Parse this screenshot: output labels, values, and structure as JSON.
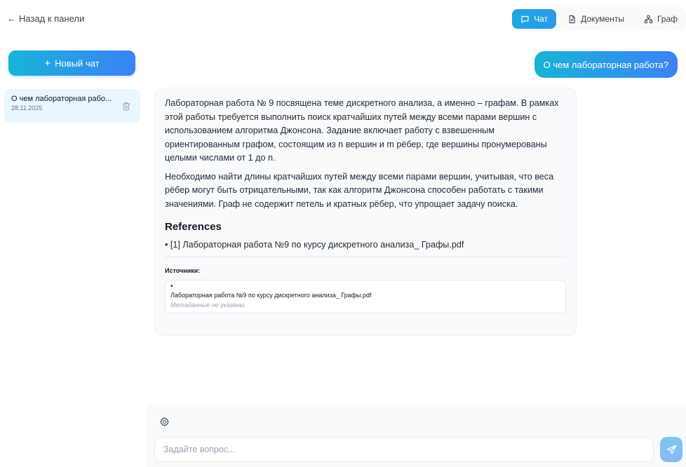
{
  "header": {
    "back_label": "Назад к панели",
    "tabs": [
      {
        "label": "Чат",
        "icon": "chat-icon",
        "active": true
      },
      {
        "label": "Документы",
        "icon": "document-icon",
        "active": false
      },
      {
        "label": "Граф",
        "icon": "graph-icon",
        "active": false
      }
    ]
  },
  "sidebar": {
    "new_chat_label": "Новый чат",
    "chats": [
      {
        "title": "О чем лабораторная рабо...",
        "date": "28.11.2025"
      }
    ]
  },
  "conversation": {
    "user_message": "О чем лабораторная работа?",
    "answer": {
      "paragraphs": [
        "Лабораторная работа № 9 посвящена теме дискретного анализа, а именно – графам. В рамках этой работы требуется выполнить поиск кратчайших путей между всеми парами вершин с использованием алгоритма Джонсона. Задание включает работу с взвешенным ориентированным графом, состоящим из n вершин и m рёбер, где вершины пронумерованы целыми числами от 1 до n.",
        "Необходимо найти длины кратчайших путей между всеми парами вершин, учитывая, что веса рёбер могут быть отрицательными, так как алгоритм Джонсона способен работать с такими значениями. Граф не содержит петель и кратных рёбер, что упрощает задачу поиска."
      ],
      "references_heading": "References",
      "references": [
        "[1] Лабораторная работа №9 по курсу дискретного анализа_ Графы.pdf"
      ],
      "sources_label": "Источники:",
      "sources": [
        {
          "bullet": "•",
          "title": "Лабораторная работа №9 по курсу дискретного анализа_ Графы.pdf",
          "meta": "Метаданные не указаны"
        }
      ]
    }
  },
  "composer": {
    "placeholder": "Задайте вопрос...",
    "value": ""
  },
  "colors": {
    "accent_start": "#19b3d6",
    "accent_end": "#3b82f6",
    "card_bg": "#f8fafc",
    "chat_item_bg": "#eaf6fd"
  }
}
